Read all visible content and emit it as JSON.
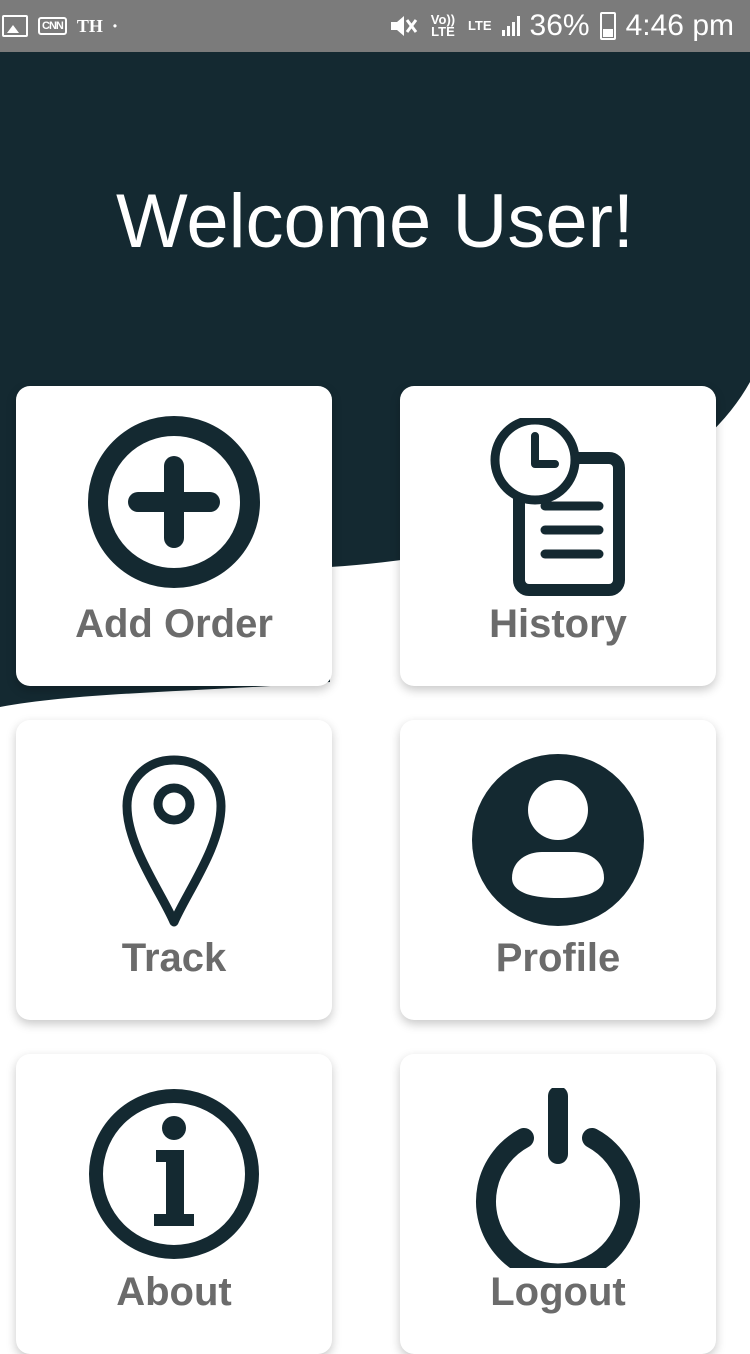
{
  "status_bar": {
    "left_icons": [
      "image-icon",
      "cnn-icon",
      "th-icon",
      "dot-icon"
    ],
    "cnn": "CNN",
    "th": "TH",
    "volte": "Vo)) LTE",
    "lte": "LTE",
    "battery": "36%",
    "time": "4:46 pm"
  },
  "header": {
    "welcome": "Welcome User!",
    "color": "#142931"
  },
  "menu": {
    "add_order": {
      "label": "Add Order",
      "icon": "add-circle-icon"
    },
    "history": {
      "label": "History",
      "icon": "history-document-icon"
    },
    "track": {
      "label": "Track",
      "icon": "location-pin-icon"
    },
    "profile": {
      "label": "Profile",
      "icon": "user-circle-icon"
    },
    "about": {
      "label": "About",
      "icon": "info-circle-icon"
    },
    "logout": {
      "label": "Logout",
      "icon": "power-icon"
    }
  },
  "colors": {
    "accent": "#142931",
    "label": "#6b6b6b",
    "status_bar": "#7b7b7b"
  }
}
